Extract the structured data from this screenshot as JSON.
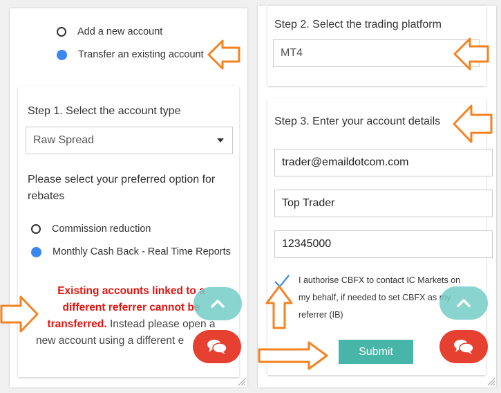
{
  "left": {
    "options": [
      "Add a new account",
      "Transfer an existing account"
    ],
    "step1_title": "Step 1. Select the account type",
    "account_type": "Raw Spread",
    "rebate_prompt_line1": "Please select your preferred option for",
    "rebate_prompt_line2": "rebates",
    "rebate_options": [
      "Commission reduction",
      "Monthly Cash Back - Real Time Reports"
    ],
    "warning_red_line1": "Existing accounts linked to a",
    "warning_red_line2": "different referrer cannot be",
    "warning_red_line3": "transferred.",
    "warning_rest_line3": " Instead please open a",
    "warning_rest_line4": "new account using a different e"
  },
  "right": {
    "step2_title": "Step 2. Select the trading platform",
    "platform": "MT4",
    "step3_title": "Step 3. Enter your account details",
    "email": "trader@emaildotcom.com",
    "name": "Top Trader",
    "account_number": "12345000",
    "consent_line1": "I authorise CBFX to contact IC Markets on",
    "consent_line2": "my behalf, if needed to set CBFX as my",
    "consent_line3": "referrer (IB)",
    "submit_label": "Submit"
  },
  "colors": {
    "arrow": "#f58220",
    "radio_selected": "#3b87f0",
    "submit": "#47b5a8",
    "chat": "#e64030",
    "scroll_up": "#76ccc8",
    "warning": "#e3140f"
  },
  "icons": [
    "chevron-up-icon",
    "chat-bubbles-icon",
    "checkmark-icon",
    "arrow-left-icon",
    "arrow-right-icon",
    "arrow-up-icon",
    "resize-grip-icon",
    "caret-down-icon"
  ]
}
